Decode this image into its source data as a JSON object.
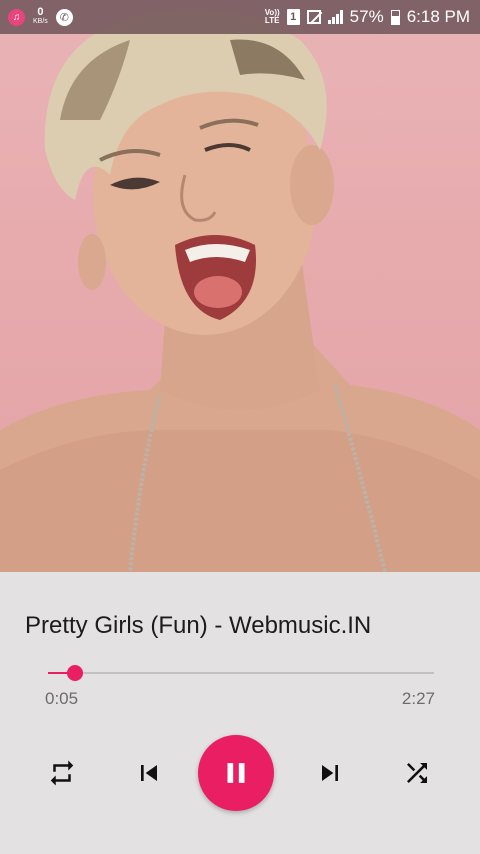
{
  "status_bar": {
    "data_rate": "0",
    "data_unit": "KB/s",
    "volte": "Vo)) LTE",
    "sim": "1",
    "battery": "57%",
    "time": "6:18 PM"
  },
  "player": {
    "song_title": "Pretty Girls (Fun) - Webmusic.IN",
    "current_time": "0:05",
    "total_time": "2:27",
    "progress": 0.034
  },
  "colors": {
    "accent": "#e91e63",
    "background": "#e4e1e2",
    "status_bar": "#6e5458"
  },
  "controls": [
    "repeat-icon",
    "previous-icon",
    "pause-icon",
    "next-icon",
    "shuffle-icon"
  ]
}
